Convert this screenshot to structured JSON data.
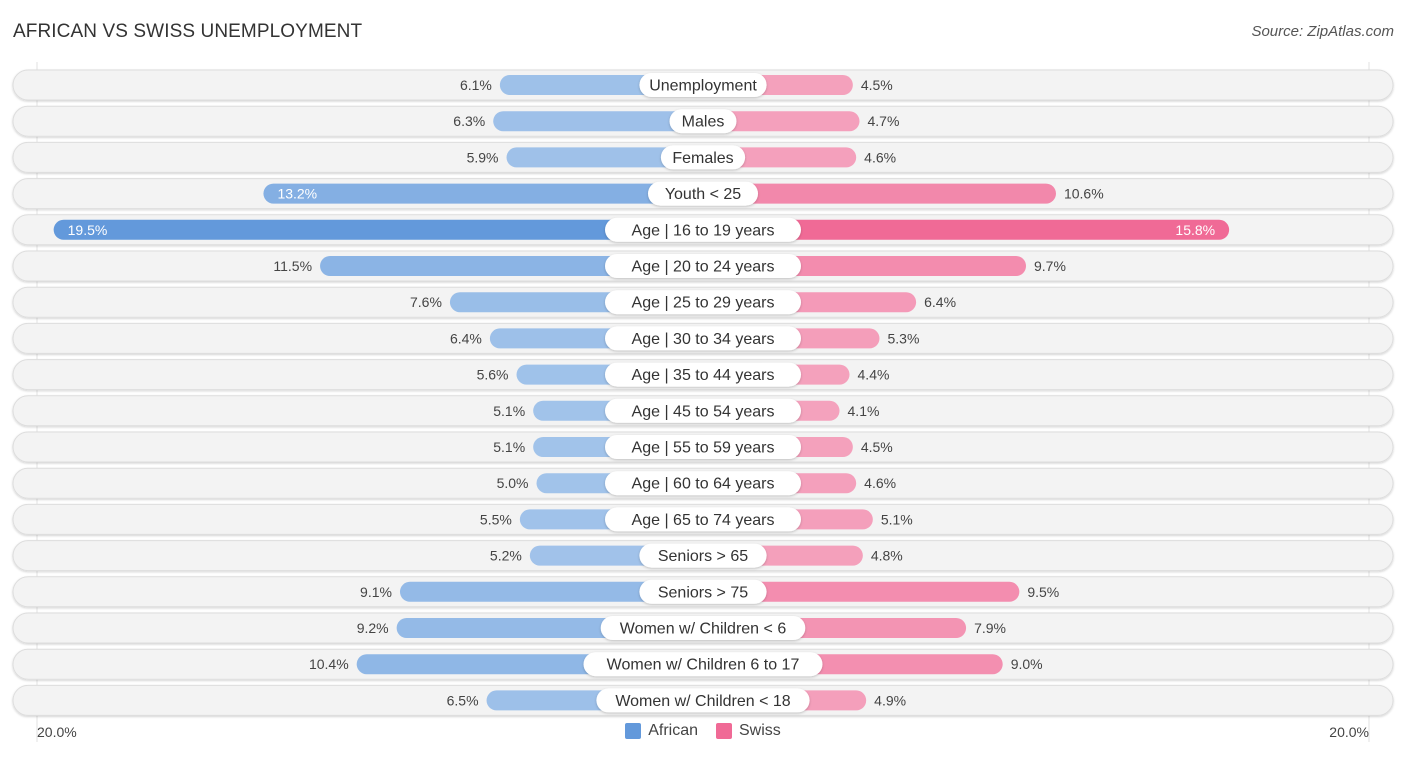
{
  "header": {
    "title": "AFRICAN VS SWISS UNEMPLOYMENT",
    "source": "Source: ZipAtlas.com"
  },
  "axis": {
    "left_label": "20.0%",
    "right_label": "20.0%"
  },
  "legend": [
    {
      "name": "African",
      "color": "#6399db"
    },
    {
      "name": "Swiss",
      "color": "#f06a96"
    }
  ],
  "chart_data": {
    "type": "bar",
    "orientation": "horizontal-diverging",
    "title": "AFRICAN VS SWISS UNEMPLOYMENT",
    "xlabel": "",
    "ylabel": "",
    "xlim": [
      -20,
      20
    ],
    "unit": "%",
    "legend_position": "bottom",
    "categories": [
      "Unemployment",
      "Males",
      "Females",
      "Youth < 25",
      "Age | 16 to 19 years",
      "Age | 20 to 24 years",
      "Age | 25 to 29 years",
      "Age | 30 to 34 years",
      "Age | 35 to 44 years",
      "Age | 45 to 54 years",
      "Age | 55 to 59 years",
      "Age | 60 to 64 years",
      "Age | 65 to 74 years",
      "Seniors > 65",
      "Seniors > 75",
      "Women w/ Children < 6",
      "Women w/ Children 6 to 17",
      "Women w/ Children < 18"
    ],
    "series": [
      {
        "name": "African",
        "color": "#6399db",
        "values": [
          6.1,
          6.3,
          5.9,
          13.2,
          19.5,
          11.5,
          7.6,
          6.4,
          5.6,
          5.1,
          5.1,
          5.0,
          5.5,
          5.2,
          9.1,
          9.2,
          10.4,
          6.5
        ]
      },
      {
        "name": "Swiss",
        "color": "#f06a96",
        "values": [
          4.5,
          4.7,
          4.6,
          10.6,
          15.8,
          9.7,
          6.4,
          5.3,
          4.4,
          4.1,
          4.5,
          4.6,
          5.1,
          4.8,
          9.5,
          7.9,
          9.0,
          4.9
        ]
      }
    ],
    "value_labels": {
      "African": [
        "6.1%",
        "6.3%",
        "5.9%",
        "13.2%",
        "19.5%",
        "11.5%",
        "7.6%",
        "6.4%",
        "5.6%",
        "5.1%",
        "5.1%",
        "5.0%",
        "5.5%",
        "5.2%",
        "9.1%",
        "9.2%",
        "10.4%",
        "6.5%"
      ],
      "Swiss": [
        "4.5%",
        "4.7%",
        "4.6%",
        "10.6%",
        "15.8%",
        "9.7%",
        "6.4%",
        "5.3%",
        "4.4%",
        "4.1%",
        "4.5%",
        "4.6%",
        "5.1%",
        "4.8%",
        "9.5%",
        "7.9%",
        "9.0%",
        "4.9%"
      ]
    }
  }
}
